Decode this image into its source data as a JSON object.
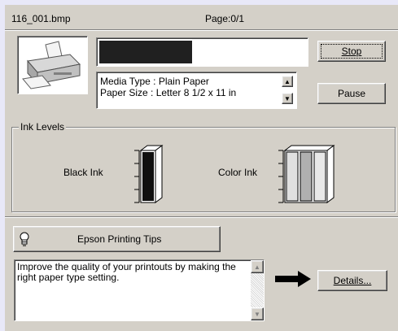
{
  "header": {
    "filename": "116_001.bmp",
    "page_status": "Page:0/1"
  },
  "progress": {
    "value_fraction": 0.45
  },
  "media_info": {
    "line1": "Media Type : Plain Paper",
    "line2": "Paper Size : Letter 8 1/2 x 11 in"
  },
  "buttons": {
    "stop": "Stop",
    "pause": "Pause",
    "tips": "Epson Printing Tips",
    "details": "Details..."
  },
  "ink_levels": {
    "group_title": "Ink Levels",
    "black_label": "Black Ink",
    "color_label": "Color Ink"
  },
  "tips_text": "Improve the quality of your printouts by making the right paper type setting.",
  "icons": {
    "printer": "printer-icon",
    "lightbulb": "lightbulb-icon",
    "arrow": "arrow-right-icon",
    "up": "scroll-up-icon",
    "down": "scroll-down-icon"
  },
  "colors": {
    "progress_fill": "#202020",
    "ink_black": "#101010",
    "ink_cyan": "#e0e0e0",
    "ink_magenta": "#b0b0b0",
    "ink_yellow": "#e8e8e8"
  }
}
